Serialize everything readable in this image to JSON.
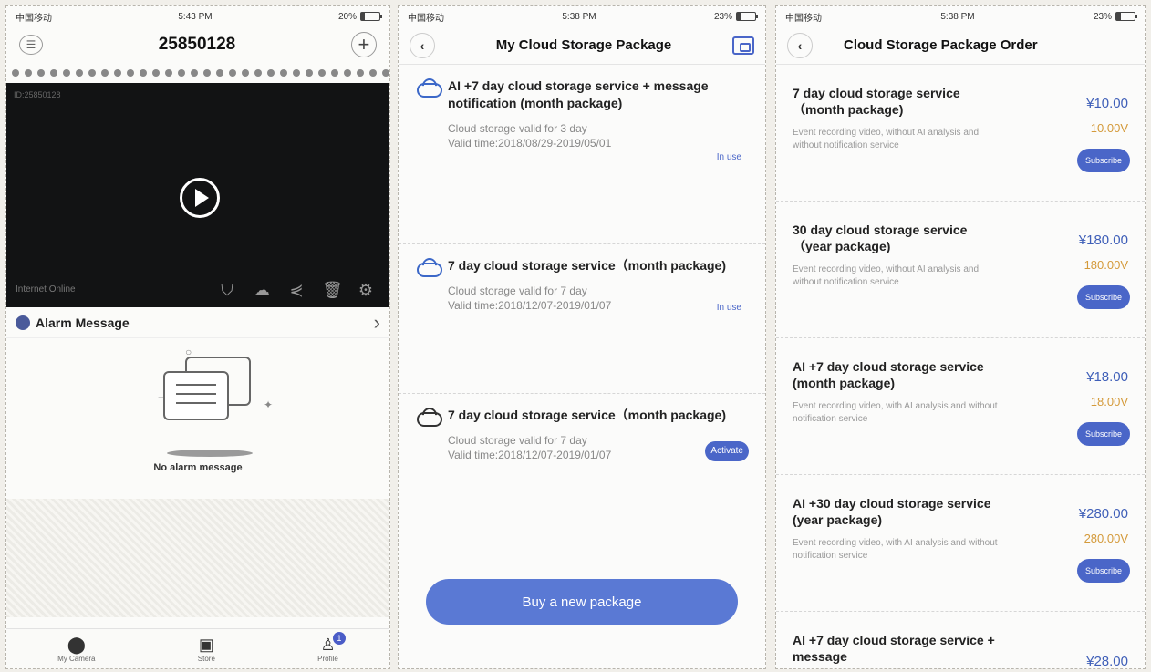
{
  "phone1": {
    "status": {
      "carrier": "中国移动",
      "time": "5:43 PM",
      "battery": "20%",
      "battery_level": 0.2
    },
    "title": "25850128",
    "camera_id": "ID:25850128",
    "online_status": "Internet Online",
    "alarm_title": "Alarm Message",
    "empty_msg": "No alarm message",
    "tabs": [
      {
        "label": "My Camera",
        "icon": "location-pin-icon"
      },
      {
        "label": "Store",
        "icon": "store-icon"
      },
      {
        "label": "Profile",
        "icon": "profile-icon",
        "badge": "1"
      }
    ]
  },
  "phone2": {
    "status": {
      "carrier": "中国移动",
      "time": "5:38 PM",
      "battery": "23%",
      "battery_level": 0.23
    },
    "title": "My Cloud Storage Package",
    "packages": [
      {
        "title": "AI +7 day cloud storage service + message notification (month package)",
        "validity": "Cloud storage valid for 3 day",
        "time": "Valid time:2018/08/29-2019/05/01",
        "status": "In use"
      },
      {
        "title": "7 day cloud storage service（month package)",
        "validity": "Cloud storage valid for 7 day",
        "time": "Valid time:2018/12/07-2019/01/07",
        "status": "In use"
      },
      {
        "title": "7 day cloud storage service（month package)",
        "validity": "Cloud storage valid for 7 day",
        "time": "Valid time:2018/12/07-2019/01/07",
        "action": "Activate"
      }
    ],
    "buy_label": "Buy a new package"
  },
  "phone3": {
    "status": {
      "carrier": "中国移动",
      "time": "5:38 PM",
      "battery": "23%",
      "battery_level": 0.23
    },
    "title": "Cloud Storage Package Order",
    "orders": [
      {
        "title": "7 day cloud storage service（month package)",
        "desc": "Event recording video, without AI analysis and without notification service",
        "price": "¥10.00",
        "vprice": "10.00V",
        "button": "Subscribe"
      },
      {
        "title": "30 day cloud storage service（year package)",
        "desc": "Event recording video, without AI analysis and without notification service",
        "price": "¥180.00",
        "vprice": "180.00V",
        "button": "Subscribe"
      },
      {
        "title": "AI +7 day cloud storage service (month package)",
        "desc": "Event recording video, with AI analysis and without notification service",
        "price": "¥18.00",
        "vprice": "18.00V",
        "button": "Subscribe"
      },
      {
        "title": "AI +30 day cloud storage service (year package)",
        "desc": "Event recording video, with AI analysis and without notification service",
        "price": "¥280.00",
        "vprice": "280.00V",
        "button": "Subscribe"
      },
      {
        "title": "AI +7 day cloud storage service + message",
        "price": "¥28.00"
      }
    ]
  },
  "colors": {
    "accent": "#4a66c8",
    "button": "#5a79d4",
    "price": "#3f5fb8",
    "vprice": "#d49a3a"
  }
}
